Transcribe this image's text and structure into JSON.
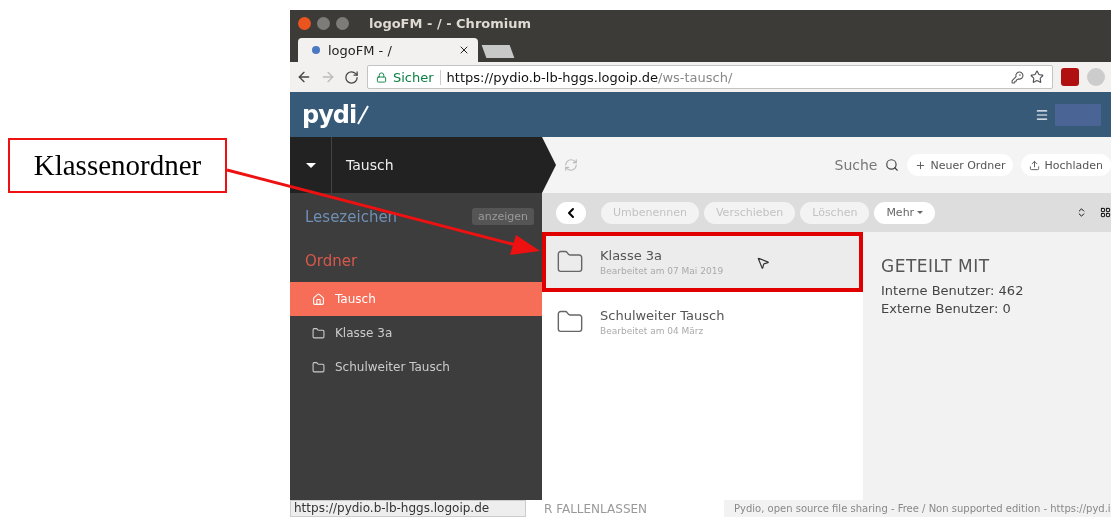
{
  "annotation": {
    "label": "Klassenordner"
  },
  "window": {
    "title": "logoFM - / - Chromium"
  },
  "browser": {
    "tabs": [
      {
        "label": "logoFM - /",
        "selected": true
      }
    ],
    "security": "Sicher",
    "url_host": "https://pydio.b-lb-hggs.logoip.de",
    "url_path": "/ws-tausch/",
    "status_url": "https://pydio.b-lb-hggs.logoip.de"
  },
  "app": {
    "logo": "pydi",
    "workspace": "Tausch",
    "search": "Suche",
    "toolbar_buttons": [
      {
        "label": "Neuer Ordner",
        "kind": "new"
      },
      {
        "label": "Hochladen",
        "kind": "upload"
      }
    ],
    "actions": [
      {
        "label": "Umbenennen",
        "disabled": true
      },
      {
        "label": "Verschieben",
        "disabled": true
      },
      {
        "label": "Löschen",
        "disabled": true
      },
      {
        "label": "Mehr",
        "disabled": false
      }
    ],
    "sidebar": {
      "bookmarks": "Lesezeichen",
      "bookmarks_button": "anzeigen",
      "folders_heading": "Ordner",
      "items": [
        {
          "label": "Tausch",
          "kind": "home",
          "selected": true
        },
        {
          "label": "Klasse 3a",
          "kind": "folder",
          "selected": false
        },
        {
          "label": "Schulweiter Tausch",
          "kind": "folder",
          "selected": false
        }
      ]
    },
    "files": [
      {
        "name": "Klasse 3a",
        "modified": "Bearbeitet am 07 Mai 2019",
        "selected": true,
        "highlighted": true
      },
      {
        "name": "Schulweiter Tausch",
        "modified": "Bearbeitet am 04 März",
        "selected": false,
        "highlighted": false
      }
    ],
    "info": {
      "title": "GETEILT MIT",
      "lines": [
        "Interne Benutzer: 462",
        "Externe Benutzer: 0"
      ]
    },
    "drop_hint": "R FALLENLASSEN",
    "footer": "Pydio, open source file sharing - Free / Non supported edition - https://pyd.i"
  }
}
